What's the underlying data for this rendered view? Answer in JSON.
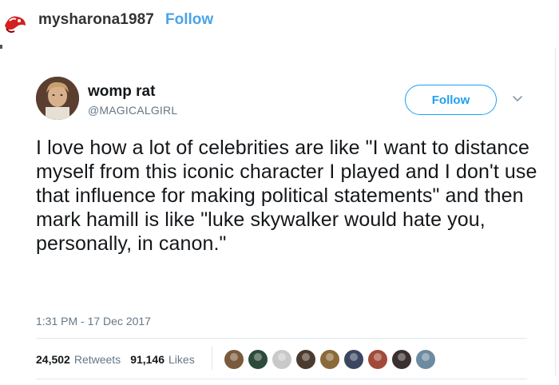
{
  "repost_header": {
    "username": "mysharona1987",
    "follow_label": "Follow"
  },
  "tweet": {
    "display_name": "womp rat",
    "handle": "@MAGICALGIRL",
    "follow_label": "Follow",
    "text": "I love how a lot of celebrities are like \"I want to distance myself from this iconic character I played and I don't use that influence for making political statements\" and then mark hamill is like \"luke skywalker would hate you, personally, in canon.\"",
    "timestamp": "1:31 PM - 17 Dec 2017",
    "retweets_count": "24,502",
    "retweets_label": "Retweets",
    "likes_count": "91,146",
    "likes_label": "Likes"
  },
  "colors": {
    "twitter_blue": "#1da1f2",
    "tumblr_follow": "#4ba3e8",
    "muted_text": "#657786"
  },
  "liker_avatars": [
    "#7a5a3c",
    "#2e4a3a",
    "#c9c9c9",
    "#4a3b2e",
    "#8a6a3a",
    "#3b4660",
    "#a14a3a",
    "#3a3030",
    "#6c8aa0"
  ]
}
